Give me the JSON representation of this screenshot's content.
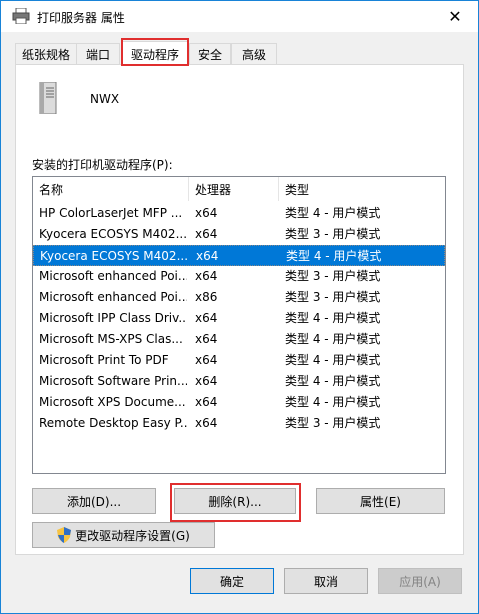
{
  "window": {
    "title": "打印服务器 属性",
    "close_glyph": "✕"
  },
  "tabs": [
    {
      "label": "纸张规格"
    },
    {
      "label": "端口"
    },
    {
      "label": "驱动程序"
    },
    {
      "label": "安全"
    },
    {
      "label": "高级"
    }
  ],
  "active_tab": "驱动程序",
  "server": {
    "name": "NWX"
  },
  "drivers": {
    "label": "安装的打印机驱动程序(P):",
    "columns": [
      "名称",
      "处理器",
      "类型"
    ],
    "rows": [
      {
        "name": "HP ColorLaserJet MFP ...",
        "processor": "x64",
        "type": "类型 4 - 用户模式"
      },
      {
        "name": "Kyocera ECOSYS M402...",
        "processor": "x64",
        "type": "类型 3 - 用户模式"
      },
      {
        "name": "Kyocera ECOSYS M402...",
        "processor": "x64",
        "type": "类型 4 - 用户模式"
      },
      {
        "name": "Microsoft enhanced Poi...",
        "processor": "x64",
        "type": "类型 3 - 用户模式"
      },
      {
        "name": "Microsoft enhanced Poi...",
        "processor": "x86",
        "type": "类型 3 - 用户模式"
      },
      {
        "name": "Microsoft IPP Class Driv...",
        "processor": "x64",
        "type": "类型 4 - 用户模式"
      },
      {
        "name": "Microsoft MS-XPS Clas...",
        "processor": "x64",
        "type": "类型 4 - 用户模式"
      },
      {
        "name": "Microsoft Print To PDF",
        "processor": "x64",
        "type": "类型 4 - 用户模式"
      },
      {
        "name": "Microsoft Software Prin...",
        "processor": "x64",
        "type": "类型 4 - 用户模式"
      },
      {
        "name": "Microsoft XPS Docume...",
        "processor": "x64",
        "type": "类型 4 - 用户模式"
      },
      {
        "name": "Remote Desktop Easy P...",
        "processor": "x64",
        "type": "类型 3 - 用户模式"
      }
    ],
    "selected_index": 2
  },
  "buttons": {
    "add": "添加(D)...",
    "remove": "删除(R)...",
    "properties": "属性(E)",
    "change_settings": "更改驱动程序设置(G)",
    "ok": "确定",
    "cancel": "取消",
    "apply": "应用(A)"
  },
  "icons": {
    "title": "printer-icon",
    "server": "server-tower-icon",
    "shield": "uac-shield-icon",
    "close": "close-icon"
  },
  "colors": {
    "selection": "#0078d7",
    "highlight": "#e02e2e",
    "window_border": "#1883d7"
  }
}
